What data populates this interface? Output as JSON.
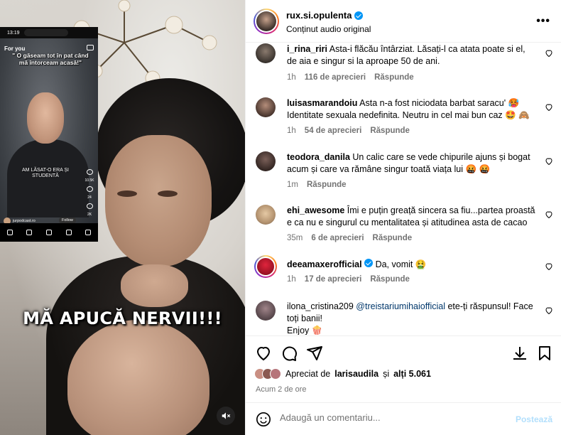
{
  "media": {
    "caption": "MĂ APUCĂ NERVII!!!",
    "phone": {
      "time": "13:19",
      "tab_label": "For you",
      "overlay_top": "\" O găseam tot în pat când mă întorceam acasă!\"",
      "overlay_mid": "AM LĂSAT-O ERA ȘI STUDENTĂ",
      "username": "jurpodcast.ro",
      "follow_label": "Follow",
      "description": "Mihai Trăistariu... Mi-a înșelat pe mine bărbatu...",
      "rail_counts": [
        "10.5K",
        "24",
        "2K"
      ]
    }
  },
  "header": {
    "username": "rux.si.opulenta",
    "subtitle": "Conținut audio original",
    "more_label": "•••"
  },
  "comments": [
    {
      "username": "i_rina_riri",
      "text": "Asta-i flăcău întârziat. Lăsați-l ca atata poate si el, de aia e singur si la aproape 50 de ani.",
      "time": "1h",
      "likes": "116 de aprecieri",
      "reply": "Răspunde"
    },
    {
      "username": "luisasmarandoiu",
      "text": "Asta n-a fost niciodata barbat saracu' 🥵 Identitate sexuala nedefinita. Neutru in cel mai bun caz 🤩 🙈",
      "time": "1h",
      "likes": "54 de aprecieri",
      "reply": "Răspunde"
    },
    {
      "username": "teodora_danila",
      "text": "Un calic care se vede chipurile ajuns și bogat acum și care va rămâne singur toată viața lui 🤬 🤬",
      "time": "1m",
      "likes": "",
      "reply": "Răspunde"
    },
    {
      "username": "ehi_awesome",
      "text": "Îmi e puțin greață sincera sa fiu...partea proastă e ca nu e singurul cu mentalitatea și atitudinea asta de cacao",
      "time": "35m",
      "likes": "6 de aprecieri",
      "reply": "Răspunde"
    },
    {
      "username": "deeamaxerofficial",
      "text": "Da, vomit 🤮",
      "time": "1h",
      "likes": "17 de aprecieri",
      "reply": "Răspunde"
    },
    {
      "username": "ilona_cristina209",
      "mention": "@treistariumihaiofficial",
      "text": "ete-ți răspunsul! Face toți banii!",
      "text2": "Enjoy 🍿",
      "time": "",
      "likes": "",
      "reply": ""
    }
  ],
  "likes": {
    "prefix": "Apreciat de",
    "user": "larisaudila",
    "mid": "și",
    "others": "alți 5.061"
  },
  "time_ago": "Acum 2 de ore",
  "add_comment": {
    "placeholder": "Adaugă un comentariu...",
    "post_label": "Postează"
  },
  "colors": {
    "verified": "#0095f6",
    "meta_text": "#737373",
    "mention": "#00376b",
    "post_disabled": "#b2dffc"
  }
}
